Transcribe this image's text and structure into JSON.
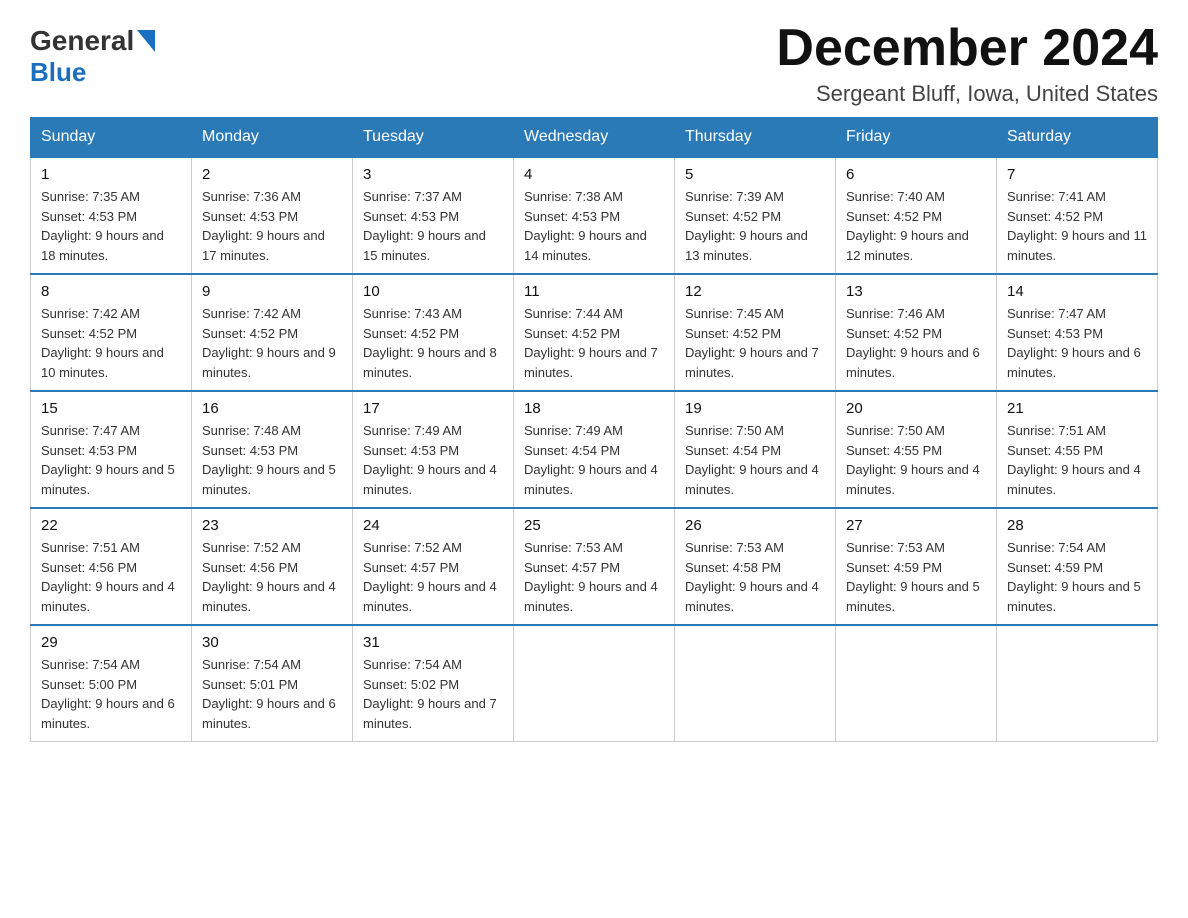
{
  "header": {
    "logo_general": "General",
    "logo_blue": "Blue",
    "month_title": "December 2024",
    "location": "Sergeant Bluff, Iowa, United States"
  },
  "days_of_week": [
    "Sunday",
    "Monday",
    "Tuesday",
    "Wednesday",
    "Thursday",
    "Friday",
    "Saturday"
  ],
  "weeks": [
    [
      {
        "day": "1",
        "sunrise": "Sunrise: 7:35 AM",
        "sunset": "Sunset: 4:53 PM",
        "daylight": "Daylight: 9 hours and 18 minutes."
      },
      {
        "day": "2",
        "sunrise": "Sunrise: 7:36 AM",
        "sunset": "Sunset: 4:53 PM",
        "daylight": "Daylight: 9 hours and 17 minutes."
      },
      {
        "day": "3",
        "sunrise": "Sunrise: 7:37 AM",
        "sunset": "Sunset: 4:53 PM",
        "daylight": "Daylight: 9 hours and 15 minutes."
      },
      {
        "day": "4",
        "sunrise": "Sunrise: 7:38 AM",
        "sunset": "Sunset: 4:53 PM",
        "daylight": "Daylight: 9 hours and 14 minutes."
      },
      {
        "day": "5",
        "sunrise": "Sunrise: 7:39 AM",
        "sunset": "Sunset: 4:52 PM",
        "daylight": "Daylight: 9 hours and 13 minutes."
      },
      {
        "day": "6",
        "sunrise": "Sunrise: 7:40 AM",
        "sunset": "Sunset: 4:52 PM",
        "daylight": "Daylight: 9 hours and 12 minutes."
      },
      {
        "day": "7",
        "sunrise": "Sunrise: 7:41 AM",
        "sunset": "Sunset: 4:52 PM",
        "daylight": "Daylight: 9 hours and 11 minutes."
      }
    ],
    [
      {
        "day": "8",
        "sunrise": "Sunrise: 7:42 AM",
        "sunset": "Sunset: 4:52 PM",
        "daylight": "Daylight: 9 hours and 10 minutes."
      },
      {
        "day": "9",
        "sunrise": "Sunrise: 7:42 AM",
        "sunset": "Sunset: 4:52 PM",
        "daylight": "Daylight: 9 hours and 9 minutes."
      },
      {
        "day": "10",
        "sunrise": "Sunrise: 7:43 AM",
        "sunset": "Sunset: 4:52 PM",
        "daylight": "Daylight: 9 hours and 8 minutes."
      },
      {
        "day": "11",
        "sunrise": "Sunrise: 7:44 AM",
        "sunset": "Sunset: 4:52 PM",
        "daylight": "Daylight: 9 hours and 7 minutes."
      },
      {
        "day": "12",
        "sunrise": "Sunrise: 7:45 AM",
        "sunset": "Sunset: 4:52 PM",
        "daylight": "Daylight: 9 hours and 7 minutes."
      },
      {
        "day": "13",
        "sunrise": "Sunrise: 7:46 AM",
        "sunset": "Sunset: 4:52 PM",
        "daylight": "Daylight: 9 hours and 6 minutes."
      },
      {
        "day": "14",
        "sunrise": "Sunrise: 7:47 AM",
        "sunset": "Sunset: 4:53 PM",
        "daylight": "Daylight: 9 hours and 6 minutes."
      }
    ],
    [
      {
        "day": "15",
        "sunrise": "Sunrise: 7:47 AM",
        "sunset": "Sunset: 4:53 PM",
        "daylight": "Daylight: 9 hours and 5 minutes."
      },
      {
        "day": "16",
        "sunrise": "Sunrise: 7:48 AM",
        "sunset": "Sunset: 4:53 PM",
        "daylight": "Daylight: 9 hours and 5 minutes."
      },
      {
        "day": "17",
        "sunrise": "Sunrise: 7:49 AM",
        "sunset": "Sunset: 4:53 PM",
        "daylight": "Daylight: 9 hours and 4 minutes."
      },
      {
        "day": "18",
        "sunrise": "Sunrise: 7:49 AM",
        "sunset": "Sunset: 4:54 PM",
        "daylight": "Daylight: 9 hours and 4 minutes."
      },
      {
        "day": "19",
        "sunrise": "Sunrise: 7:50 AM",
        "sunset": "Sunset: 4:54 PM",
        "daylight": "Daylight: 9 hours and 4 minutes."
      },
      {
        "day": "20",
        "sunrise": "Sunrise: 7:50 AM",
        "sunset": "Sunset: 4:55 PM",
        "daylight": "Daylight: 9 hours and 4 minutes."
      },
      {
        "day": "21",
        "sunrise": "Sunrise: 7:51 AM",
        "sunset": "Sunset: 4:55 PM",
        "daylight": "Daylight: 9 hours and 4 minutes."
      }
    ],
    [
      {
        "day": "22",
        "sunrise": "Sunrise: 7:51 AM",
        "sunset": "Sunset: 4:56 PM",
        "daylight": "Daylight: 9 hours and 4 minutes."
      },
      {
        "day": "23",
        "sunrise": "Sunrise: 7:52 AM",
        "sunset": "Sunset: 4:56 PM",
        "daylight": "Daylight: 9 hours and 4 minutes."
      },
      {
        "day": "24",
        "sunrise": "Sunrise: 7:52 AM",
        "sunset": "Sunset: 4:57 PM",
        "daylight": "Daylight: 9 hours and 4 minutes."
      },
      {
        "day": "25",
        "sunrise": "Sunrise: 7:53 AM",
        "sunset": "Sunset: 4:57 PM",
        "daylight": "Daylight: 9 hours and 4 minutes."
      },
      {
        "day": "26",
        "sunrise": "Sunrise: 7:53 AM",
        "sunset": "Sunset: 4:58 PM",
        "daylight": "Daylight: 9 hours and 4 minutes."
      },
      {
        "day": "27",
        "sunrise": "Sunrise: 7:53 AM",
        "sunset": "Sunset: 4:59 PM",
        "daylight": "Daylight: 9 hours and 5 minutes."
      },
      {
        "day": "28",
        "sunrise": "Sunrise: 7:54 AM",
        "sunset": "Sunset: 4:59 PM",
        "daylight": "Daylight: 9 hours and 5 minutes."
      }
    ],
    [
      {
        "day": "29",
        "sunrise": "Sunrise: 7:54 AM",
        "sunset": "Sunset: 5:00 PM",
        "daylight": "Daylight: 9 hours and 6 minutes."
      },
      {
        "day": "30",
        "sunrise": "Sunrise: 7:54 AM",
        "sunset": "Sunset: 5:01 PM",
        "daylight": "Daylight: 9 hours and 6 minutes."
      },
      {
        "day": "31",
        "sunrise": "Sunrise: 7:54 AM",
        "sunset": "Sunset: 5:02 PM",
        "daylight": "Daylight: 9 hours and 7 minutes."
      },
      null,
      null,
      null,
      null
    ]
  ]
}
